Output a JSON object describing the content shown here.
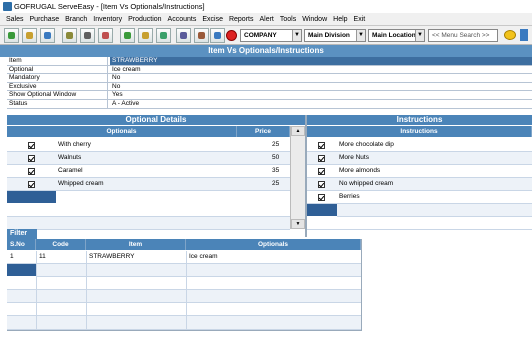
{
  "window": {
    "title": "GOFRUGAL ServeEasy - [Item Vs Optionals/Instructions]"
  },
  "menu": [
    "Sales",
    "Purchase",
    "Branch",
    "Inventory",
    "Production",
    "Accounts",
    "Excise",
    "Reports",
    "Alert",
    "Tools",
    "Window",
    "Help",
    "Exit"
  ],
  "toolbar": {
    "company": "COMPANY",
    "division": "Main Division",
    "location": "Main Location",
    "search_placeholder": "<< Menu Search >>",
    "dropdown_arrow": "▼"
  },
  "heading": "Item Vs Optionals/Instructions",
  "info": [
    {
      "label": "Item",
      "value": "STRAWBERRY"
    },
    {
      "label": "Optional",
      "value": "Ice cream"
    },
    {
      "label": "Mandatory",
      "value": "No"
    },
    {
      "label": "Exclusive",
      "value": "No"
    },
    {
      "label": "Show Optional Window",
      "value": "Yes"
    },
    {
      "label": "Status",
      "value": "A - Active"
    }
  ],
  "optional_details": {
    "title": "Optional Details",
    "col_optionals": "Optionals",
    "col_price": "Price",
    "rows": [
      {
        "name": "With cherry",
        "price": "25"
      },
      {
        "name": "Walnuts",
        "price": "50"
      },
      {
        "name": "Caramel",
        "price": "35"
      },
      {
        "name": "Whipped cream",
        "price": "25"
      }
    ]
  },
  "instructions": {
    "title": "Instructions",
    "col_instructions": "Instructions",
    "rows": [
      "More chocolate dip",
      "More Nuts",
      "More almonds",
      "No whipped cream",
      "Berries"
    ]
  },
  "filter": {
    "label": "Filter",
    "cols": [
      "S.No",
      "Code",
      "Item",
      "Optionals"
    ],
    "rows": [
      {
        "sno": "1",
        "code": "11",
        "item": "STRAWBERRY",
        "optionals": "Ice cream"
      }
    ]
  },
  "icons": {
    "scroll_up": "▲",
    "scroll_down": "▼"
  },
  "colors": {
    "header_blue": "#4b84b8",
    "selected_blue": "#2f5f96"
  }
}
